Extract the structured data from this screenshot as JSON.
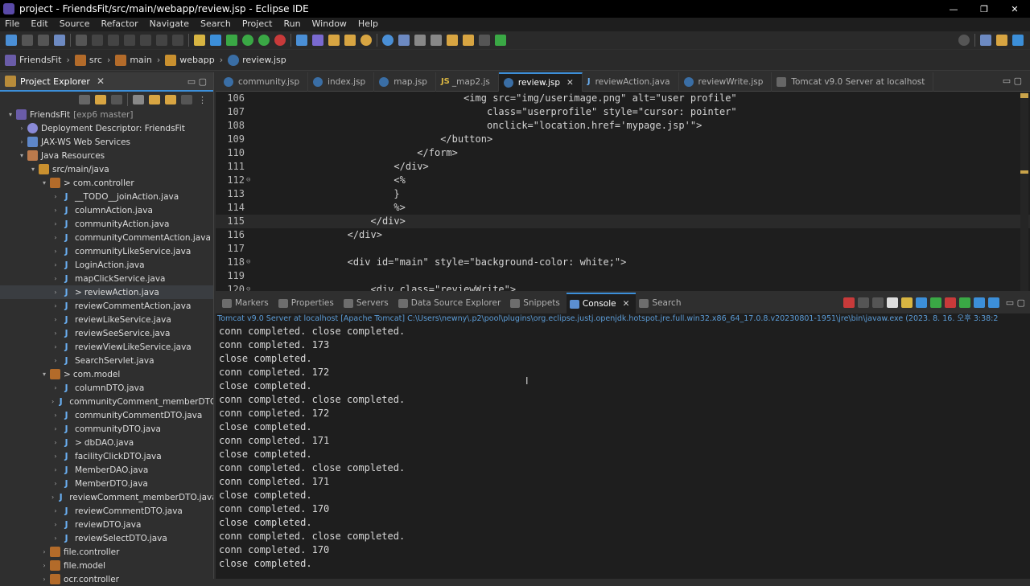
{
  "window": {
    "title": "project - FriendsFit/src/main/webapp/review.jsp - Eclipse IDE",
    "controls": [
      "—",
      "❐",
      "✕"
    ]
  },
  "menu": [
    "File",
    "Edit",
    "Source",
    "Refactor",
    "Navigate",
    "Search",
    "Project",
    "Run",
    "Window",
    "Help"
  ],
  "breadcrumb": [
    "FriendsFit",
    "src",
    "main",
    "webapp",
    "review.jsp"
  ],
  "explorer": {
    "title": "Project Explorer",
    "items": [
      {
        "depth": 0,
        "arrow": "▾",
        "icon": "proj",
        "label": "FriendsFit",
        "extra": "[exp6 master]"
      },
      {
        "depth": 1,
        "arrow": "›",
        "icon": "dd",
        "label": "Deployment Descriptor: FriendsFit"
      },
      {
        "depth": 1,
        "arrow": "›",
        "icon": "ws",
        "label": "JAX-WS Web Services"
      },
      {
        "depth": 1,
        "arrow": "▾",
        "icon": "jr",
        "label": "Java Resources"
      },
      {
        "depth": 2,
        "arrow": "▾",
        "icon": "src",
        "label": "src/main/java"
      },
      {
        "depth": 3,
        "arrow": "▾",
        "icon": "pkg",
        "label": "com.controller",
        "dirty": ">"
      },
      {
        "depth": 4,
        "arrow": "›",
        "icon": "java",
        "label": "__TODO__joinAction.java"
      },
      {
        "depth": 4,
        "arrow": "›",
        "icon": "java",
        "label": "columnAction.java"
      },
      {
        "depth": 4,
        "arrow": "›",
        "icon": "java",
        "label": "communityAction.java"
      },
      {
        "depth": 4,
        "arrow": "›",
        "icon": "java",
        "label": "communityCommentAction.java"
      },
      {
        "depth": 4,
        "arrow": "›",
        "icon": "java",
        "label": "communityLikeService.java"
      },
      {
        "depth": 4,
        "arrow": "›",
        "icon": "java",
        "label": "LoginAction.java"
      },
      {
        "depth": 4,
        "arrow": "›",
        "icon": "java",
        "label": "mapClickService.java"
      },
      {
        "depth": 4,
        "arrow": "›",
        "icon": "java",
        "label": "reviewAction.java",
        "dirty": ">",
        "sel": true
      },
      {
        "depth": 4,
        "arrow": "›",
        "icon": "java",
        "label": "reviewCommentAction.java"
      },
      {
        "depth": 4,
        "arrow": "›",
        "icon": "java",
        "label": "reviewLikeService.java"
      },
      {
        "depth": 4,
        "arrow": "›",
        "icon": "java",
        "label": "reviewSeeService.java"
      },
      {
        "depth": 4,
        "arrow": "›",
        "icon": "java",
        "label": "reviewViewLikeService.java"
      },
      {
        "depth": 4,
        "arrow": "›",
        "icon": "java",
        "label": "SearchServlet.java"
      },
      {
        "depth": 3,
        "arrow": "▾",
        "icon": "pkg",
        "label": "com.model",
        "dirty": ">"
      },
      {
        "depth": 4,
        "arrow": "›",
        "icon": "java",
        "label": "columnDTO.java"
      },
      {
        "depth": 4,
        "arrow": "›",
        "icon": "java",
        "label": "communityComment_memberDTO.java"
      },
      {
        "depth": 4,
        "arrow": "›",
        "icon": "java",
        "label": "communityCommentDTO.java"
      },
      {
        "depth": 4,
        "arrow": "›",
        "icon": "java",
        "label": "communityDTO.java"
      },
      {
        "depth": 4,
        "arrow": "›",
        "icon": "java",
        "label": "dbDAO.java",
        "dirty": ">"
      },
      {
        "depth": 4,
        "arrow": "›",
        "icon": "java",
        "label": "facilityClickDTO.java"
      },
      {
        "depth": 4,
        "arrow": "›",
        "icon": "java",
        "label": "MemberDAO.java"
      },
      {
        "depth": 4,
        "arrow": "›",
        "icon": "java",
        "label": "MemberDTO.java"
      },
      {
        "depth": 4,
        "arrow": "›",
        "icon": "java",
        "label": "reviewComment_memberDTO.java"
      },
      {
        "depth": 4,
        "arrow": "›",
        "icon": "java",
        "label": "reviewCommentDTO.java"
      },
      {
        "depth": 4,
        "arrow": "›",
        "icon": "java",
        "label": "reviewDTO.java"
      },
      {
        "depth": 4,
        "arrow": "›",
        "icon": "java",
        "label": "reviewSelectDTO.java"
      },
      {
        "depth": 3,
        "arrow": "›",
        "icon": "pkg",
        "label": "file.controller"
      },
      {
        "depth": 3,
        "arrow": "›",
        "icon": "pkg",
        "label": "file.model"
      },
      {
        "depth": 3,
        "arrow": "›",
        "icon": "pkg",
        "label": "ocr.controller"
      }
    ]
  },
  "editor_tabs": [
    {
      "label": "community.jsp",
      "icon": "jsp"
    },
    {
      "label": "index.jsp",
      "icon": "jsp"
    },
    {
      "label": "map.jsp",
      "icon": "jsp"
    },
    {
      "label": "_map2.js",
      "icon": "js"
    },
    {
      "label": "review.jsp",
      "icon": "jsp",
      "active": true
    },
    {
      "label": "reviewAction.java",
      "icon": "java"
    },
    {
      "label": "reviewWrite.jsp",
      "icon": "jsp"
    },
    {
      "label": "Tomcat v9.0 Server at localhost",
      "icon": "srv"
    }
  ],
  "code": [
    {
      "n": "106",
      "t": "                                    <img src=\"img/userimage.png\" alt=\"user profile\""
    },
    {
      "n": "107",
      "t": "                                        class=\"userprofile\" style=\"cursor: pointer\""
    },
    {
      "n": "108",
      "t": "                                        onclick=\"location.href='mypage.jsp'\">"
    },
    {
      "n": "109",
      "t": "                                </button>"
    },
    {
      "n": "110",
      "t": "                            </form>"
    },
    {
      "n": "111",
      "t": "                        </div>"
    },
    {
      "n": "112",
      "t": "                        <%",
      "fold": true
    },
    {
      "n": "113",
      "t": "                        }"
    },
    {
      "n": "114",
      "t": "                        %>"
    },
    {
      "n": "115",
      "t": "                    </div>",
      "current": true
    },
    {
      "n": "116",
      "t": "                </div>"
    },
    {
      "n": "117",
      "t": ""
    },
    {
      "n": "118",
      "t": "                <div id=\"main\" style=\"background-color: white;\">",
      "fold": true
    },
    {
      "n": "119",
      "t": ""
    },
    {
      "n": "120",
      "t": "                    <div class=\"reviewWrite\">",
      "fold": true
    }
  ],
  "console_tabs": [
    {
      "label": "Markers"
    },
    {
      "label": "Properties"
    },
    {
      "label": "Servers"
    },
    {
      "label": "Data Source Explorer"
    },
    {
      "label": "Snippets"
    },
    {
      "label": "Console",
      "active": true
    },
    {
      "label": "Search"
    }
  ],
  "console": {
    "description": "Tomcat v9.0 Server at localhost [Apache Tomcat] C:\\Users\\newny\\.p2\\pool\\plugins\\org.eclipse.justj.openjdk.hotspot.jre.full.win32.x86_64_17.0.8.v20230801-1951\\jre\\bin\\javaw.exe  (2023. 8. 16. 오후 3:38:2",
    "lines": [
      "conn completed. close completed.",
      "conn completed. 173",
      "close completed.",
      "conn completed. 172",
      "close completed.",
      "conn completed. close completed.",
      "conn completed. 172",
      "close completed.",
      "conn completed. 171",
      "close completed.",
      "conn completed. close completed.",
      "conn completed. 171",
      "close completed.",
      "conn completed. 170",
      "close completed.",
      "conn completed. close completed.",
      "conn completed. 170",
      "close completed."
    ]
  }
}
